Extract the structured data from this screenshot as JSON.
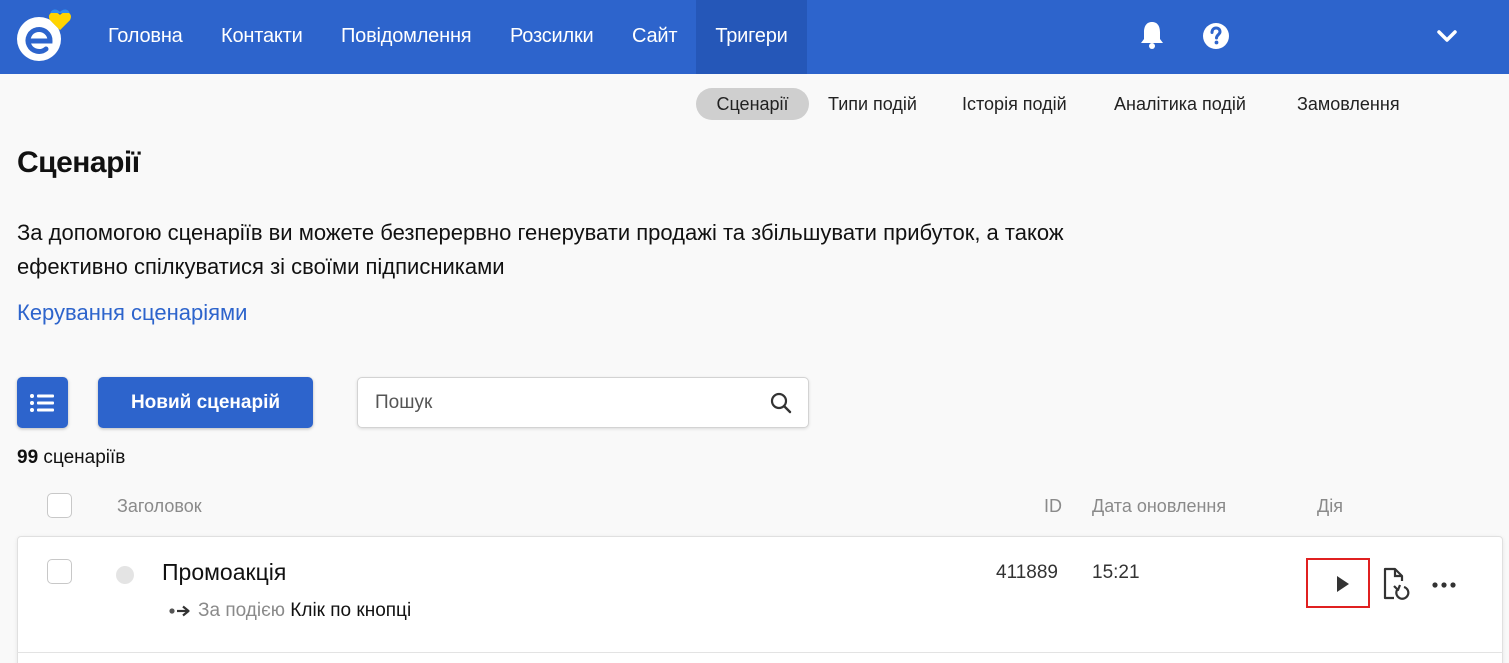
{
  "nav": {
    "items": [
      {
        "label": "Головна"
      },
      {
        "label": "Контакти"
      },
      {
        "label": "Повідомлення"
      },
      {
        "label": "Розсилки"
      },
      {
        "label": "Сайт"
      },
      {
        "label": "Тригери"
      }
    ],
    "active": "Тригери",
    "icons": [
      "bell-icon",
      "help-icon",
      "chevron-down-icon"
    ],
    "colors": {
      "background": "#2d64cc",
      "active": "#2557b8"
    }
  },
  "subnav": {
    "items": [
      {
        "label": "Сценарії"
      },
      {
        "label": "Типи подій"
      },
      {
        "label": "Історія подій"
      },
      {
        "label": "Аналітика подій"
      },
      {
        "label": "Замовлення"
      }
    ],
    "active": "Сценарії"
  },
  "page": {
    "title": "Сценарії",
    "description_line1": "За допомогою сценаріїв ви можете безперервно генерувати продажі та збільшувати прибуток, а також",
    "description_line2": "ефективно спілкуватися зі своїми підписниками",
    "manage_link": "Керування сценаріями"
  },
  "toolbar": {
    "new_button": "Новий сценарій",
    "search_placeholder": "Пошук"
  },
  "summary": {
    "count": "99",
    "count_label": "сценаріїв"
  },
  "table": {
    "headers": {
      "title": "Заголовок",
      "id": "ID",
      "date": "Дата оновлення",
      "action": "Дія"
    },
    "rows": [
      {
        "title": "Промоакція",
        "trigger_label": "За подією",
        "trigger_value": "Клік по кнопці",
        "id": "411889",
        "date": "15:21"
      }
    ]
  }
}
